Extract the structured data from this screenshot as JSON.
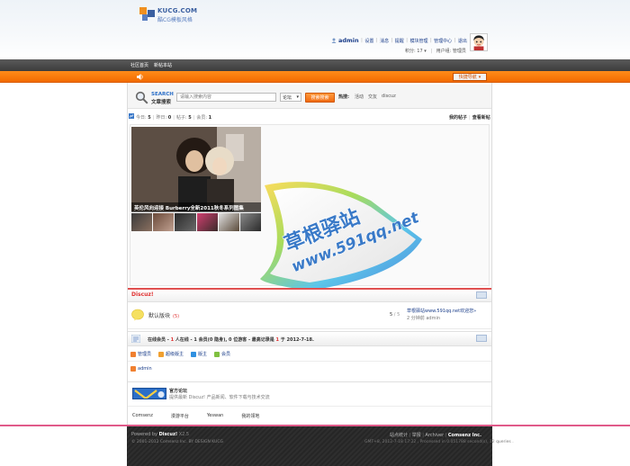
{
  "header": {
    "logo_text": "KUCG.COM",
    "logo_sub": "酷CG模板风格",
    "username": "admin",
    "user_links": [
      "设置",
      "消息",
      "提醒",
      "模块管理",
      "管理中心",
      "退出"
    ],
    "credits": "积分: 17",
    "user_group": "用户组: 管理员"
  },
  "nav": {
    "items": [
      "社区首页",
      "新帖本站"
    ],
    "quick_nav": "快捷导航"
  },
  "search": {
    "title": "SEARCH",
    "subtitle": "文章搜索",
    "placeholder": "请输入搜索内容",
    "scope": "论坛",
    "button": "搜索搜索",
    "hot_label": "热搜:",
    "hot_items": [
      "活动",
      "交友",
      "discuz"
    ]
  },
  "stats": {
    "today_label": "今日:",
    "today_value": "5",
    "yesterday_label": "昨日:",
    "yesterday_value": "0",
    "posts_label": "帖子:",
    "posts_value": "5",
    "members_label": "会员:",
    "members_value": "1",
    "my_posts": "我的帖子",
    "new_posts": "查看新帖"
  },
  "slide": {
    "caption": "英伦风向迎接 Burberry全新2011秋冬系列图集",
    "watermark_line1": "草根驿站",
    "watermark_line2": "www.591qq.net"
  },
  "category": {
    "title": "Discuz!",
    "forum_name": "默认版块",
    "forum_new": "(5)",
    "threads": "5",
    "total": "5",
    "last_title": "草根驿站www.591qq.net欢迎您»",
    "last_meta": "2 分钟前  admin"
  },
  "online": {
    "prefix": "在线会员 - ",
    "total": "1",
    "mid1": " 人在线 - ",
    "members": "1",
    "mid2": " 会员(0 隐身), ",
    "guests": "0",
    "mid3": " 位游客 - 最高记录是 ",
    "record": "1",
    "mid4": " 于 ",
    "record_date": "2012-7-18",
    "end": ".",
    "legend": [
      "管理员",
      "超级版主",
      "版主",
      "会员"
    ],
    "legend_colors": [
      "#f08030",
      "#f0a030",
      "#3090e0",
      "#80c040"
    ],
    "users": [
      "admin"
    ]
  },
  "links": {
    "official_title": "官方论坛",
    "official_desc": "提供最新 Discuz! 产品新闻、软件下载与技术交流",
    "text_links": [
      "Comsenz",
      "漫游平台",
      "Yeswan",
      "我的领地"
    ]
  },
  "footer": {
    "powered_label": "Powered by",
    "powered_name": "Discuz!",
    "version": "X2.5",
    "copyright": "© 2001-2012 Comsenz Inc.  BY DESIGN KUCG",
    "links": [
      "站点统计",
      "举报",
      "Archiver"
    ],
    "company": "Comsenz Inc.",
    "time_info": "GMT+8, 2012-7-18 17:22 , Processed in 0.051788 second(s), 12 queries ."
  }
}
